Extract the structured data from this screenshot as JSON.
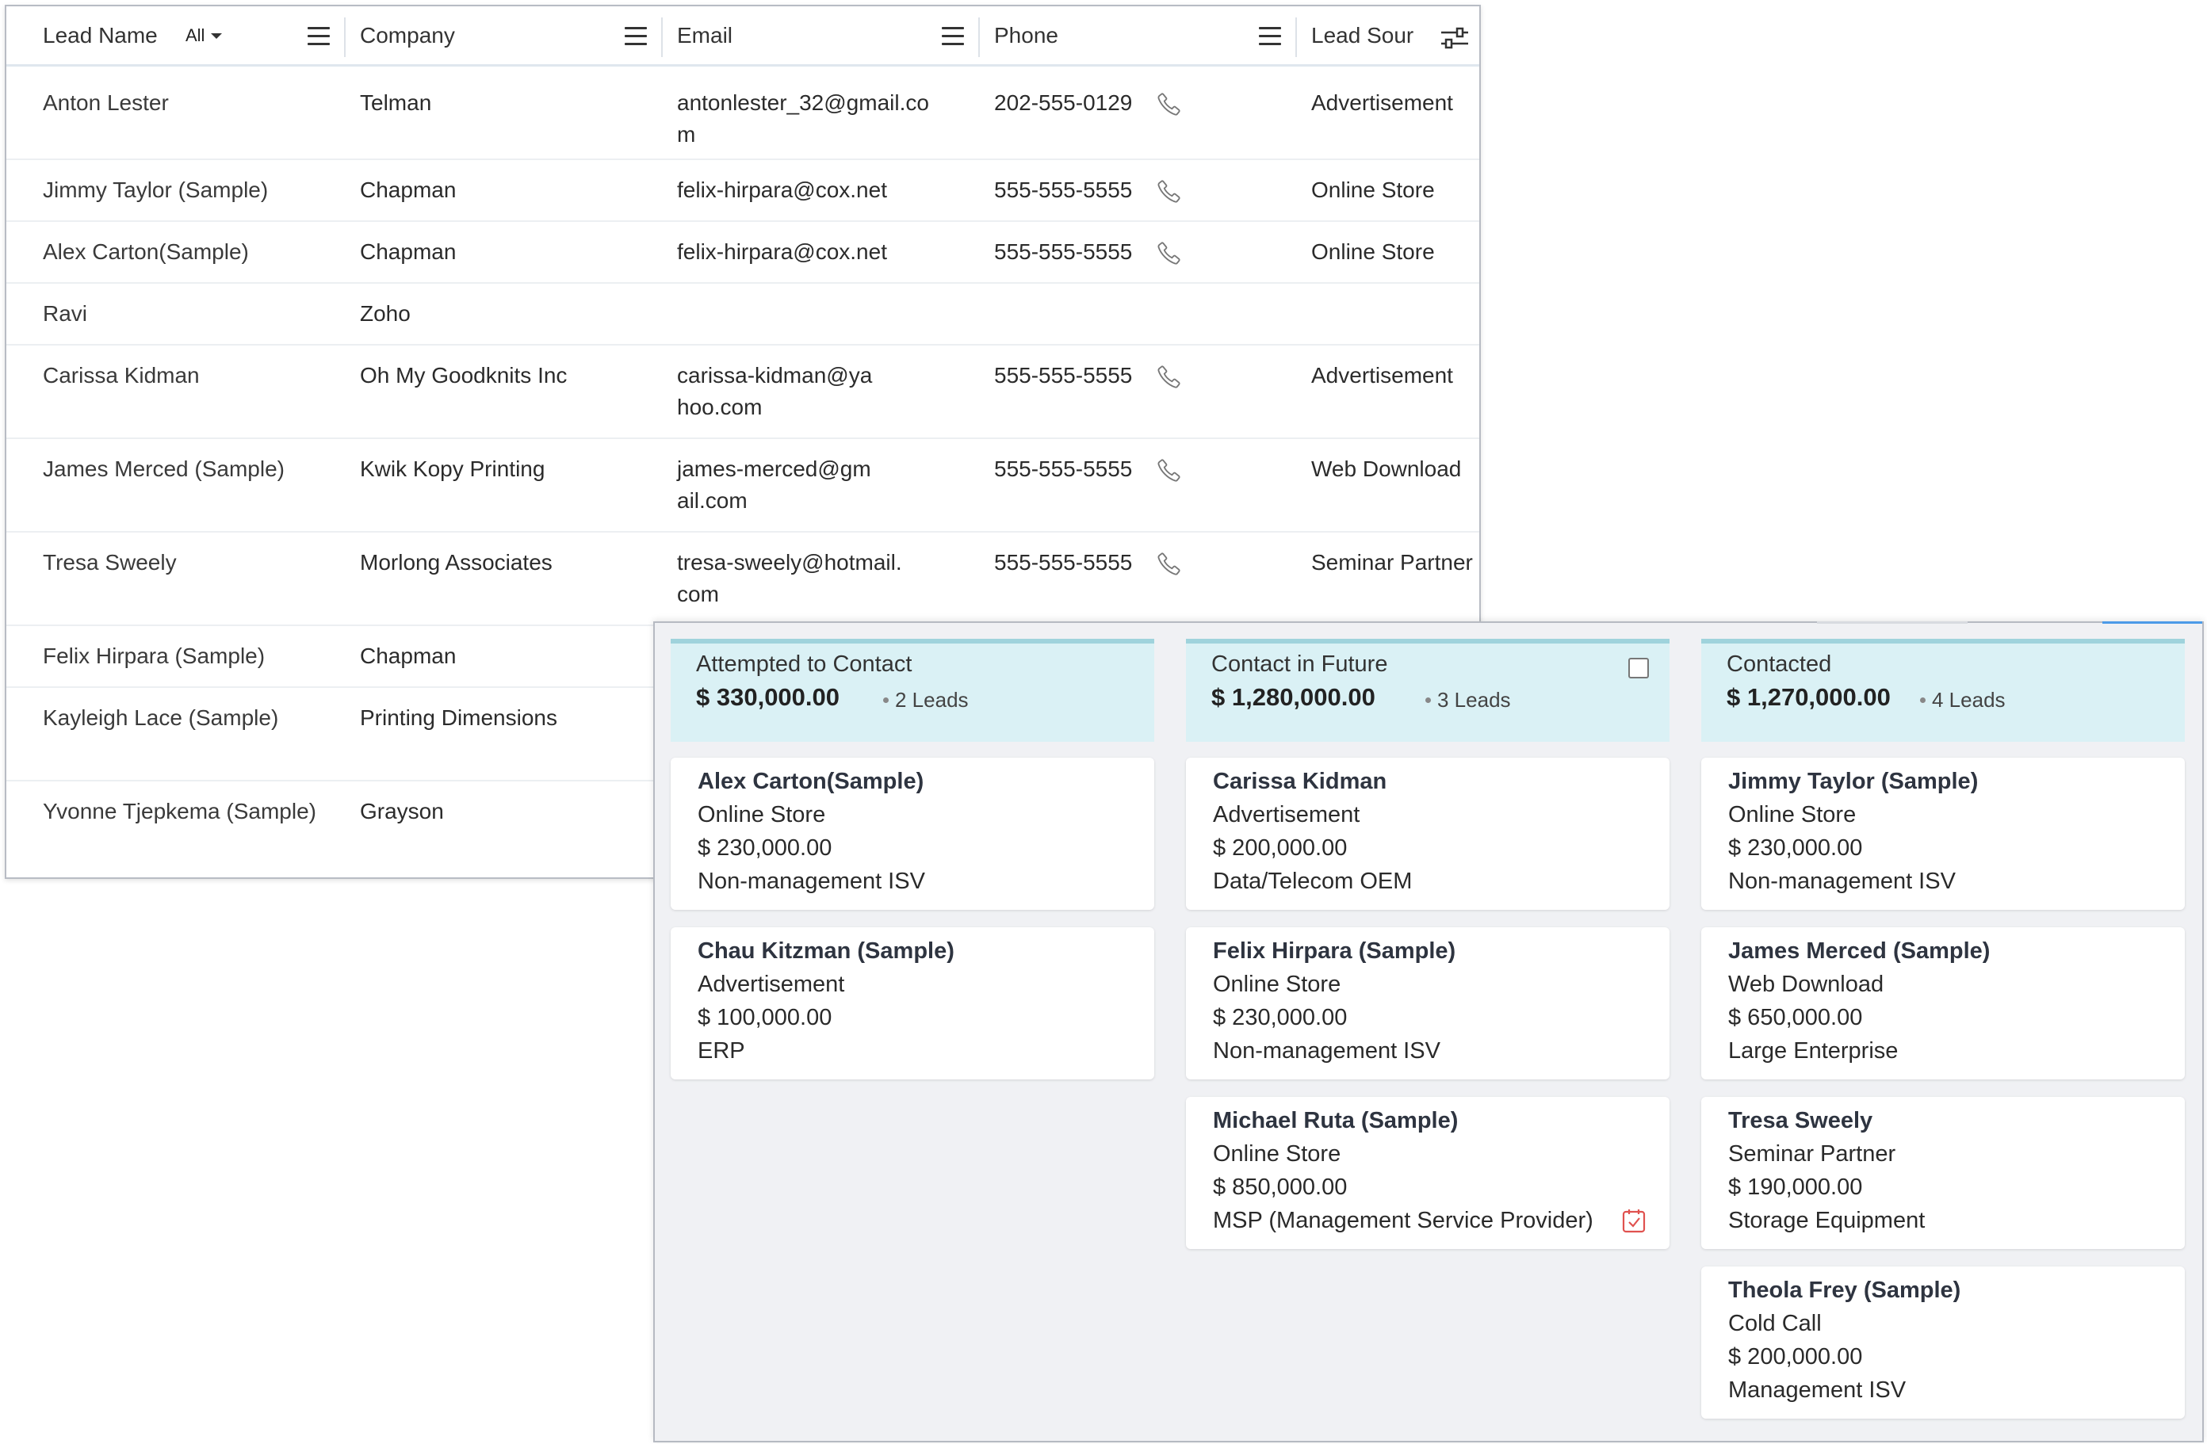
{
  "list": {
    "headers": {
      "lead_name": "Lead Name",
      "filter": "All",
      "company": "Company",
      "email": "Email",
      "phone": "Phone",
      "lead_source": "Lead Sour"
    },
    "rows": [
      {
        "name": "Anton Lester",
        "company": "Telman",
        "email": "antonlester_32@gmail.com",
        "phone": "202-555-0129",
        "source": "Advertisement"
      },
      {
        "name": "Jimmy Taylor (Sample)",
        "company": "Chapman",
        "email": "felix-hirpara@cox.net",
        "phone": "555-555-5555",
        "source": "Online Store"
      },
      {
        "name": "Alex Carton(Sample)",
        "company": "Chapman",
        "email": "felix-hirpara@cox.net",
        "phone": "555-555-5555",
        "source": "Online Store"
      },
      {
        "name": "Ravi",
        "company": "Zoho",
        "email": "",
        "phone": "",
        "source": ""
      },
      {
        "name": "Carissa Kidman",
        "company": "Oh My Goodknits Inc",
        "email": "carissa-kidman@yahoo.com",
        "phone": "555-555-5555",
        "source": "Advertisement"
      },
      {
        "name": "James Merced (Sample)",
        "company": "Kwik Kopy Printing",
        "email": "james-merced@gmail.com",
        "phone": "555-555-5555",
        "source": "Web Download"
      },
      {
        "name": "Tresa Sweely",
        "company": "Morlong Associates",
        "email": "tresa-sweely@hotmail.com",
        "phone": "555-555-5555",
        "source": "Seminar Partner"
      },
      {
        "name": "Felix Hirpara (Sample)",
        "company": "Chapman",
        "email": "",
        "phone": "",
        "source": ""
      },
      {
        "name": "Kayleigh Lace (Sample)",
        "company": "Printing Dimensions",
        "email": "",
        "phone": "",
        "source": ""
      },
      {
        "name": "Yvonne Tjepkema (Sample)",
        "company": "Grayson",
        "email": "",
        "phone": "",
        "source": ""
      }
    ]
  },
  "kanban": {
    "columns": [
      {
        "title": "Attempted to Contact",
        "sum": "$ 330,000.00",
        "count": "2 Leads",
        "cards": [
          {
            "name": "Alex Carton(Sample)",
            "source": "Online Store",
            "amount": "$ 230,000.00",
            "industry": "Non-management ISV"
          },
          {
            "name": "Chau Kitzman (Sample)",
            "source": "Advertisement",
            "amount": "$ 100,000.00",
            "industry": "ERP"
          }
        ]
      },
      {
        "title": "Contact in Future",
        "sum": "$ 1,280,000.00",
        "count": "3 Leads",
        "cards": [
          {
            "name": "Carissa Kidman",
            "source": "Advertisement",
            "amount": "$ 200,000.00",
            "industry": "Data/Telecom OEM"
          },
          {
            "name": "Felix Hirpara (Sample)",
            "source": "Online Store",
            "amount": "$ 230,000.00",
            "industry": "Non-management ISV"
          },
          {
            "name": "Michael Ruta (Sample)",
            "source": "Online Store",
            "amount": "$ 850,000.00",
            "industry": "MSP (Management Service Provider)"
          }
        ]
      },
      {
        "title": "Contacted",
        "sum": "$ 1,270,000.00",
        "count": "4 Leads",
        "cards": [
          {
            "name": "Jimmy Taylor (Sample)",
            "source": "Online Store",
            "amount": "$ 230,000.00",
            "industry": "Non-management ISV"
          },
          {
            "name": "James Merced (Sample)",
            "source": "Web Download",
            "amount": "$ 650,000.00",
            "industry": "Large Enterprise"
          },
          {
            "name": "Tresa Sweely",
            "source": "Seminar Partner",
            "amount": "$ 190,000.00",
            "industry": "Storage Equipment"
          },
          {
            "name": "Theola Frey (Sample)",
            "source": "Cold Call",
            "amount": "$ 200,000.00",
            "industry": "Management ISV"
          }
        ]
      }
    ]
  },
  "icons": {
    "column_menu": "menu-icon",
    "column_settings": "column-settings-icon",
    "phone": "phone-icon",
    "task": "task-icon",
    "select": "checkbox-icon"
  },
  "colors": {
    "column_header_bg": "#daf1f5",
    "column_header_border": "#9fd3dc",
    "board_bg": "#f0f1f4",
    "task_icon": "#e0524f"
  }
}
